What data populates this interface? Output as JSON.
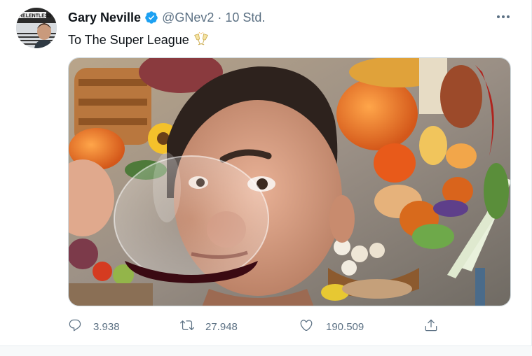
{
  "tweet": {
    "author_name": "Gary Neville",
    "handle": "@GNev2",
    "separator": "·",
    "time": "10 Std.",
    "text": "To The Super League",
    "emoji_icon": "clinking-glasses-icon",
    "avatar_text": "RELENTLESS",
    "verified_icon": "verified-badge-icon",
    "more_icon": "more-dots-icon"
  },
  "actions": {
    "reply": {
      "icon": "reply-icon",
      "count": "3.938"
    },
    "retweet": {
      "icon": "retweet-icon",
      "count": "27.948"
    },
    "like": {
      "icon": "heart-icon",
      "count": "190.509"
    },
    "share": {
      "icon": "share-icon"
    }
  },
  "colors": {
    "verified_blue": "#1da1f2",
    "secondary_text": "#5b7083",
    "primary_text": "#0f1419"
  }
}
